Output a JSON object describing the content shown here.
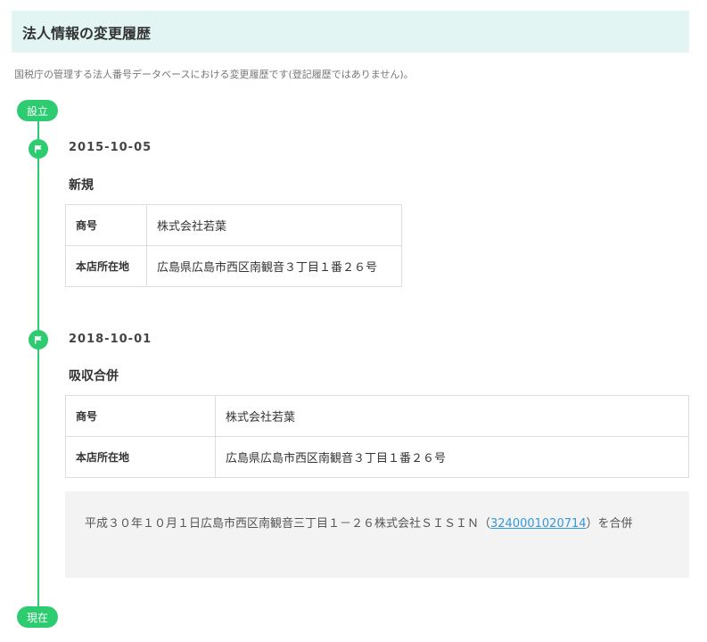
{
  "header": {
    "title": "法人情報の変更履歴"
  },
  "description": "国税庁の管理する法人番号データベースにおける変更履歴です(登記履歴ではありません)。",
  "timeline": {
    "start_label": "設立",
    "end_label": "現在",
    "entries": [
      {
        "date": "2015-10-05",
        "event": "新規",
        "rows": [
          {
            "key": "商号",
            "value": "株式会社若葉"
          },
          {
            "key": "本店所在地",
            "value": "広島県広島市西区南観音３丁目１番２６号"
          }
        ]
      },
      {
        "date": "2018-10-01",
        "event": "吸収合併",
        "rows": [
          {
            "key": "商号",
            "value": "株式会社若葉"
          },
          {
            "key": "本店所在地",
            "value": "広島県広島市西区南観音３丁目１番２６号"
          }
        ],
        "note": {
          "text_before": "平成３０年１０月１日広島市西区南観音三丁目１－２６株式会社ＳＩＳＩＮ（",
          "link": "3240001020714",
          "text_after": "）を合併"
        }
      }
    ]
  },
  "colors": {
    "accent": "#2ecc71",
    "header_bg": "#e2f5f2",
    "link": "#3498db"
  },
  "icons": {
    "entry_marker": "flag-icon"
  }
}
